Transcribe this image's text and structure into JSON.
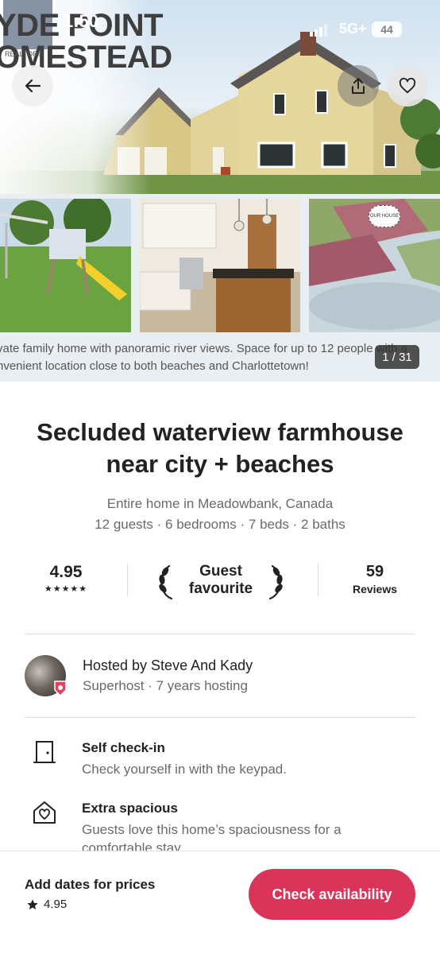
{
  "status_bar": {
    "time": "1:50",
    "network": "5G+",
    "battery": "44"
  },
  "hero": {
    "sign_line1": "YDE POINT",
    "sign_line2": "OMESTEAD",
    "realtor_mark": "REALTOR®",
    "thumbnail_sign": "OUR HOUSE",
    "caption_line1": "vate family home with panoramic river views. Space for up to 12 people with a",
    "caption_line2": "nvenient location close to both beaches and Charlottetown!",
    "photo_counter": "1 / 31"
  },
  "listing": {
    "title": "Secluded waterview farmhouse near city + beaches",
    "subtitle": "Entire home in Meadowbank, Canada",
    "details": "12 guests · 6 bedrooms · 7 beds · 2 baths"
  },
  "stats": {
    "rating": "4.95",
    "stars": "★★★★★",
    "guest_favourite_line1": "Guest",
    "guest_favourite_line2": "favourite",
    "reviews_count": "59",
    "reviews_label": "Reviews"
  },
  "host": {
    "name": "Hosted by Steve And Kady",
    "subtitle": "Superhost · 7 years hosting"
  },
  "features": [
    {
      "icon": "door-icon",
      "title": "Self check-in",
      "description": "Check yourself in with the keypad."
    },
    {
      "icon": "house-heart-icon",
      "title": "Extra spacious",
      "description": "Guests love this home’s spaciousness for a comfortable stay"
    }
  ],
  "footer": {
    "price_label": "Add dates for prices",
    "rating": "4.95",
    "cta_label": "Check availability"
  },
  "colors": {
    "accent": "#d9345a",
    "text_primary": "#222222",
    "text_secondary": "#6a6a6a",
    "divider": "#dddddd"
  }
}
